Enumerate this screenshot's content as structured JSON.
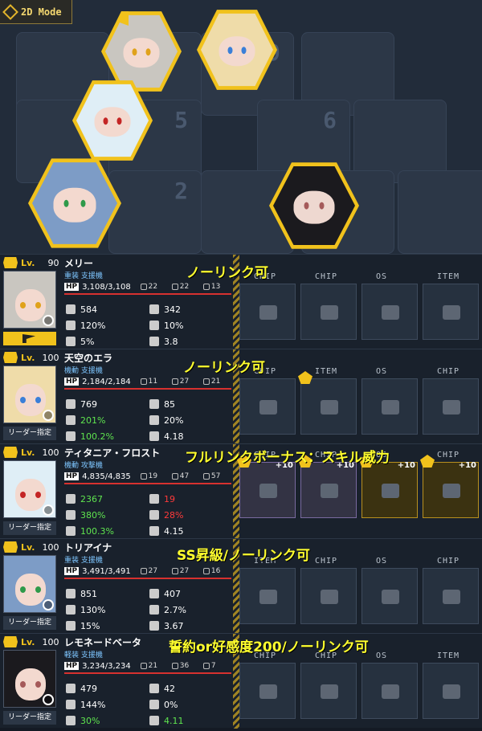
{
  "header": {
    "mode_label": "2D Mode"
  },
  "map": {
    "tile_numbers": [
      "9",
      "5",
      "6",
      "2"
    ]
  },
  "slot_types": {
    "chip": "CHIP",
    "os": "OS",
    "item": "ITEM"
  },
  "units": [
    {
      "name": "メリー",
      "type": "重装 支援機",
      "level": "90",
      "hp": "3,108/3,108",
      "m1": "22",
      "m2": "22",
      "m3": "13",
      "atk": "584",
      "def": "342",
      "acc": "120%",
      "eva": "10%",
      "crit": "5%",
      "spd": "3.8",
      "leader": "",
      "note": "ノーリンク可",
      "slots": [
        "CHIP",
        "CHIP",
        "OS",
        "ITEM"
      ]
    },
    {
      "name": "天空のエラ",
      "type": "機動 支援機",
      "level": "100",
      "hp": "2,184/2,184",
      "m1": "11",
      "m2": "27",
      "m3": "21",
      "atk": "769",
      "def": "85",
      "acc": "201%",
      "eva": "20%",
      "crit": "100.2%",
      "spd": "4.18",
      "leader": "リーダー指定",
      "note": "ノーリンク可",
      "slots": [
        "CHIP",
        "ITEM",
        "OS",
        "CHIP"
      ]
    },
    {
      "name": "ティタニア・フロスト",
      "type": "機動 攻撃機",
      "level": "100",
      "hp": "4,835/4,835",
      "m1": "19",
      "m2": "47",
      "m3": "57",
      "atk": "2367",
      "def": "19",
      "acc": "380%",
      "eva": "28%",
      "crit": "100.3%",
      "spd": "4.15",
      "leader": "リーダー指定",
      "note": "フルリンクボーナス：スキル威力",
      "slots": [
        "CHIP",
        "CHIP",
        "OS",
        "CHIP"
      ],
      "plus": "+10"
    },
    {
      "name": "トリアイナ",
      "type": "重装 支援機",
      "level": "100",
      "hp": "3,491/3,491",
      "m1": "27",
      "m2": "27",
      "m3": "16",
      "atk": "851",
      "def": "407",
      "acc": "130%",
      "eva": "2.7%",
      "crit": "15%",
      "spd": "3.67",
      "leader": "リーダー指定",
      "note": "SS昇級/ノーリンク可",
      "slots": [
        "ITEM",
        "CHIP",
        "OS",
        "CHIP"
      ]
    },
    {
      "name": "レモネードベータ",
      "type": "軽装 支援機",
      "level": "100",
      "hp": "3,234/3,234",
      "m1": "21",
      "m2": "36",
      "m3": "7",
      "atk": "479",
      "def": "42",
      "acc": "144%",
      "eva": "0%",
      "crit": "30%",
      "spd": "4.11",
      "leader": "リーダー指定",
      "note": "誓約or好感度200/ノーリンク可",
      "slots": [
        "CHIP",
        "CHIP",
        "OS",
        "ITEM"
      ]
    }
  ],
  "lv_label": "Lv.",
  "hp_label": "HP",
  "colors": {
    "accent": "#f1c21c",
    "note": "#ffff2e",
    "hp_bar": "#d7312f",
    "green": "#5fe44f",
    "red": "#ff3a3a"
  }
}
